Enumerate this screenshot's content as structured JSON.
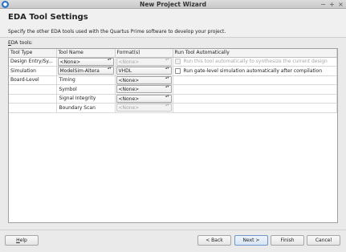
{
  "window": {
    "title": "New Project Wizard",
    "app_icon_glyph": "●",
    "controls": {
      "minimize": "−",
      "maximize": "+",
      "close": "×"
    }
  },
  "header": {
    "title": "EDA Tool Settings",
    "subtitle": "Specify the other EDA tools used with the Quartus Prime software to develop your project."
  },
  "tools_label_mnemonic": "E",
  "tools_label_rest": "DA tools:",
  "table": {
    "columns": [
      "Tool Type",
      "Tool Name",
      "Format(s)",
      "Run Tool Automatically"
    ],
    "rows": [
      {
        "type": "Design Entry/Sy...",
        "name": "<None>",
        "name_combo": true,
        "format": "<None>",
        "format_disabled": true,
        "run": "Run this tool automatically to synthesize the current design",
        "run_disabled": true
      },
      {
        "type": "Simulation",
        "name": "ModelSim-Altera",
        "name_combo": true,
        "format": "VHDL",
        "format_disabled": false,
        "run": "Run gate-level simulation automatically after compilation",
        "run_disabled": false
      },
      {
        "type": "Board-Level",
        "name": "Timing",
        "name_combo": false,
        "format": "<None>",
        "format_disabled": false,
        "run": "",
        "run_disabled": false
      },
      {
        "type": "",
        "name": "Symbol",
        "name_combo": false,
        "format": "<None>",
        "format_disabled": false,
        "run": "",
        "run_disabled": false
      },
      {
        "type": "",
        "name": "Signal Integrity",
        "name_combo": false,
        "format": "<None>",
        "format_disabled": false,
        "run": "",
        "run_disabled": false
      },
      {
        "type": "",
        "name": "Boundary Scan",
        "name_combo": false,
        "format": "<None>",
        "format_disabled": true,
        "run": "",
        "run_disabled": false
      }
    ]
  },
  "buttons": {
    "help": "Help",
    "back": "< Back",
    "next": "Next >",
    "finish": "Finish",
    "cancel": "Cancel"
  },
  "colors": {
    "accent": "#2a73c9",
    "disabled_text": "#a6a6a6"
  },
  "icons": {
    "combo_arrows": "▴▾"
  }
}
